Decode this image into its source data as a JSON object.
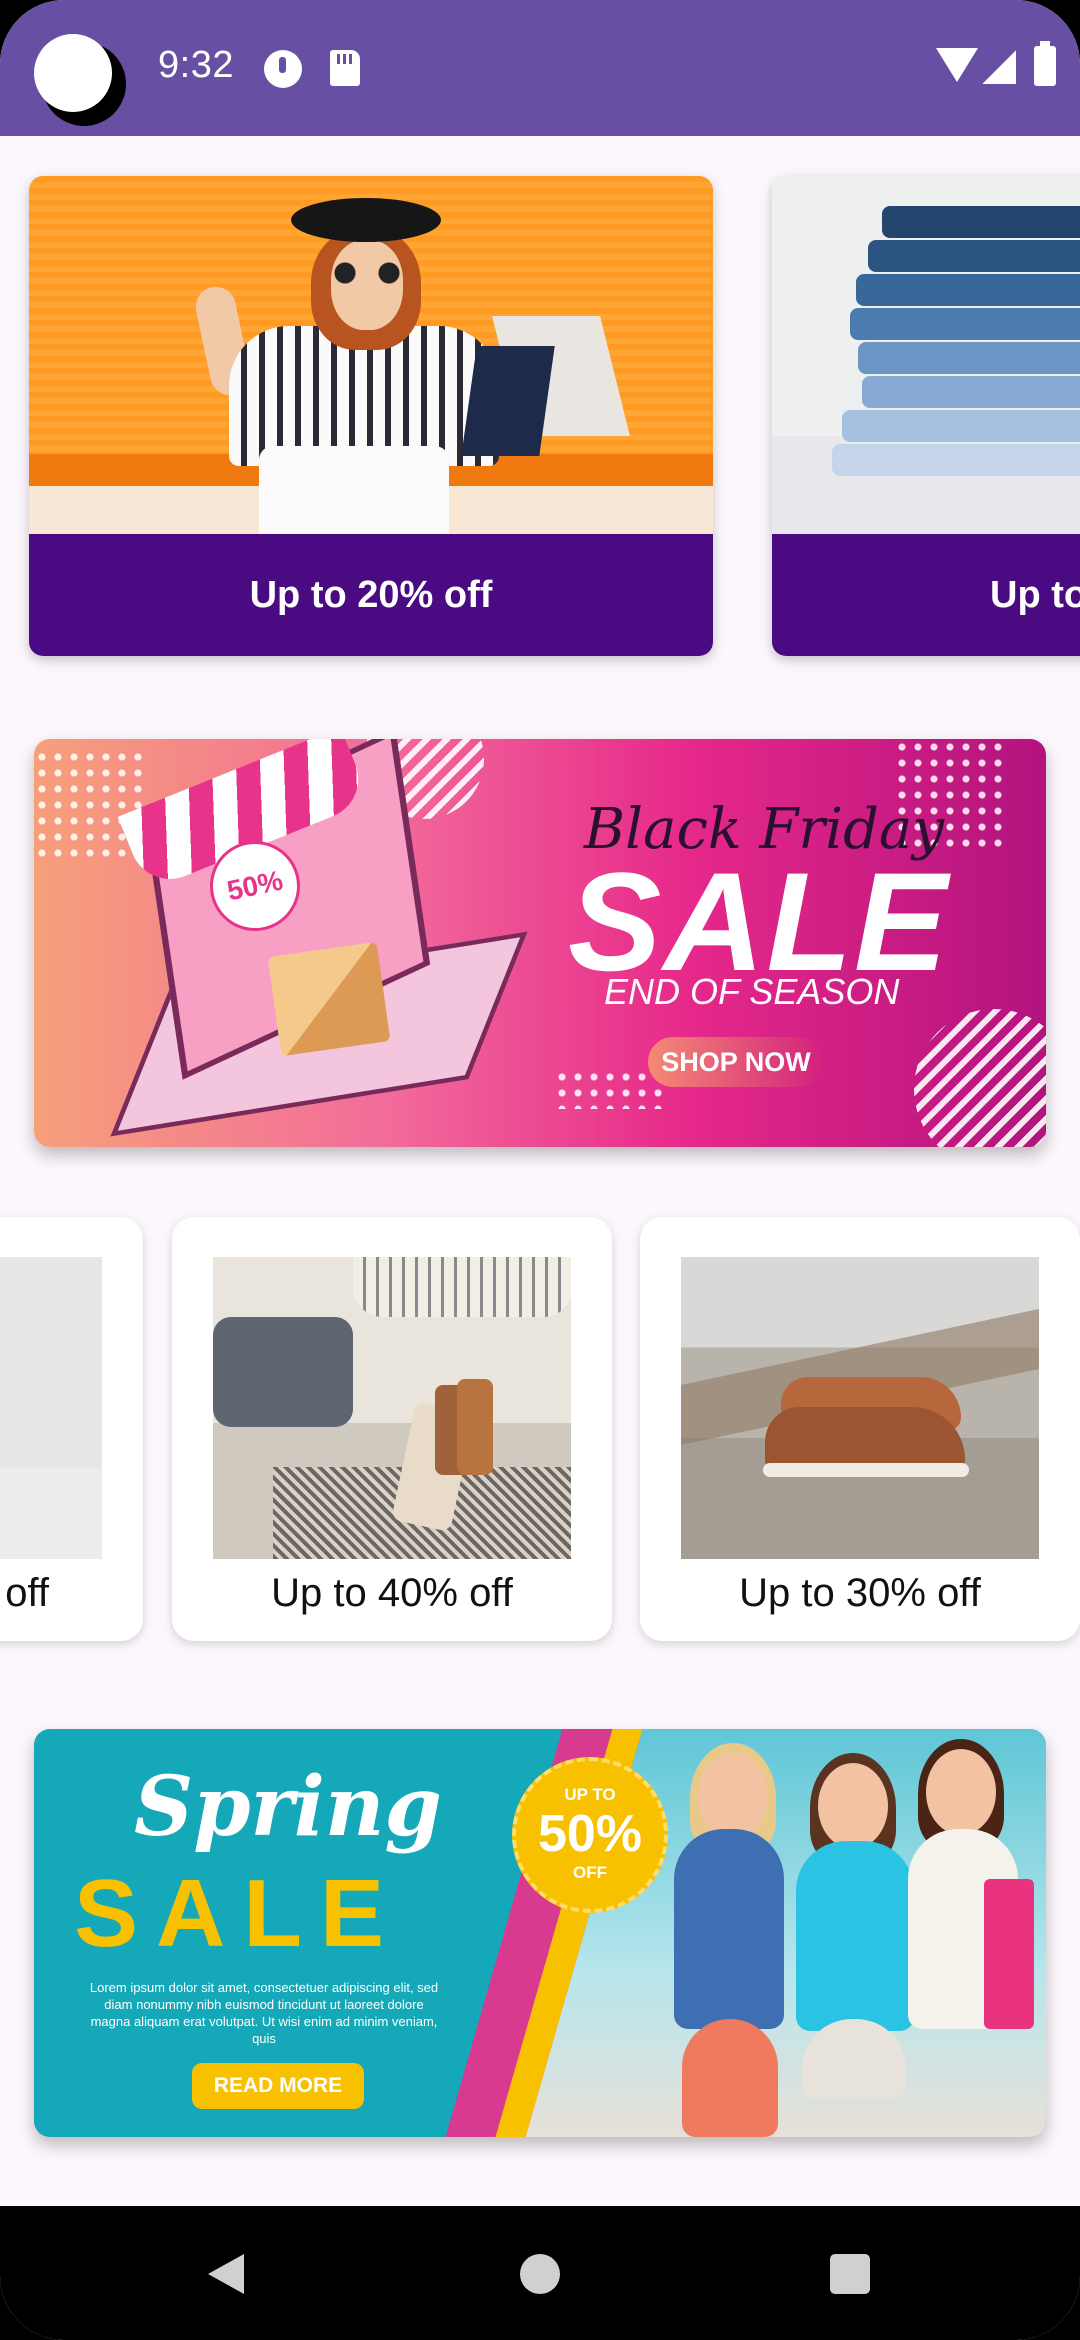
{
  "status_bar": {
    "time": "9:32",
    "icons": [
      "camera-cutout",
      "alert-icon",
      "sd-card-icon",
      "wifi-icon",
      "signal-icon",
      "battery-icon"
    ],
    "background_color": "#6750a4"
  },
  "top_carousel": {
    "cards": [
      {
        "label": "Up to 20% off",
        "image": "woman-with-shopping-bags"
      },
      {
        "label": "Up to",
        "image": "stack-of-jeans"
      }
    ],
    "band_color": "#4a0a82"
  },
  "black_friday_banner": {
    "headline": "Black Friday",
    "sale_text": "SALE",
    "subtitle": "END OF SEASON",
    "button_label": "SHOP NOW",
    "badge_text": "50%"
  },
  "product_row": {
    "cards": [
      {
        "label": "off",
        "image": "white-wall"
      },
      {
        "label": "Up to 40% off",
        "image": "woman-trying-shoes"
      },
      {
        "label": "Up to 30% off",
        "image": "boat-shoes"
      }
    ]
  },
  "spring_banner": {
    "title": "Spring",
    "sale_text": "SALE",
    "badge_small": "UP TO",
    "badge_big": "50%",
    "badge_bottom": "OFF",
    "body_text": "Lorem ipsum dolor sit amet, consectetuer adipiscing elit, sed diam nonummy nibh euismod tincidunt ut laoreet dolore magna aliquam erat volutpat. Ut wisi enim ad minim veniam, quis",
    "button_label": "READ MORE"
  },
  "nav_bar": {
    "buttons": [
      "back-icon",
      "home-icon",
      "recents-icon"
    ]
  }
}
